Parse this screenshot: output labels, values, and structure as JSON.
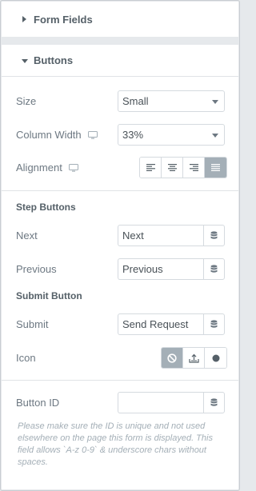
{
  "sections": {
    "form_fields": {
      "title": "Form Fields",
      "expanded": false
    },
    "buttons": {
      "title": "Buttons",
      "expanded": true
    }
  },
  "controls": {
    "size": {
      "label": "Size",
      "value": "Small"
    },
    "column_width": {
      "label": "Column Width",
      "value": "33%",
      "responsive_icon": "desktop-icon"
    },
    "alignment": {
      "label": "Alignment",
      "responsive_icon": "desktop-icon",
      "options": [
        "align-left-icon",
        "align-center-icon",
        "align-right-icon",
        "align-justify-icon"
      ],
      "selected": "align-justify-icon"
    }
  },
  "step_buttons": {
    "heading": "Step Buttons",
    "next": {
      "label": "Next",
      "value": "Next"
    },
    "previous": {
      "label": "Previous",
      "value": "Previous"
    }
  },
  "submit_button": {
    "heading": "Submit Button",
    "submit": {
      "label": "Submit",
      "value": "Send Request"
    },
    "icon": {
      "label": "Icon",
      "options": [
        "ban-icon",
        "upload-icon",
        "circle-icon"
      ],
      "selected": "ban-icon"
    }
  },
  "button_id": {
    "label": "Button ID",
    "value": "",
    "note": "Please make sure the ID is unique and not used elsewhere on the page this form is displayed. This field allows `A-z 0-9` & underscore chars without spaces."
  },
  "colors": {
    "active_toggle": "#a4afb7",
    "label_text": "#6d7882",
    "heading_text": "#556068",
    "note_text": "#a4afb7"
  }
}
